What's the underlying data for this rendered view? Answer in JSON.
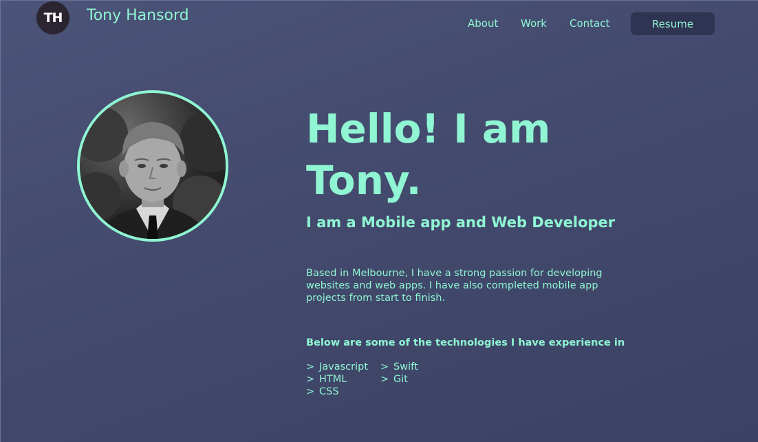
{
  "header": {
    "logo_initials": "TH",
    "brand_name": "Tony Hansord",
    "nav": {
      "about": "About",
      "work": "Work",
      "contact": "Contact",
      "resume": "Resume"
    }
  },
  "hero": {
    "title": "Hello! I am Tony.",
    "subtitle": "I am a Mobile app and Web Developer",
    "bio": "Based in Melbourne, I have a strong passion for developing websites and web apps. I have also completed mobile app projects from start to finish.",
    "tech_heading": "Below are some of the technologies I have experience in",
    "tech_marker": ">",
    "tech_column_1": [
      "Javascript",
      "HTML",
      "CSS"
    ],
    "tech_column_2": [
      "Swift",
      "Git"
    ]
  },
  "colors": {
    "accent": "#8ff5d2",
    "background": "#434a6d",
    "button_bg": "#2f3453",
    "logo_bg": "#2a2530"
  },
  "icons": {
    "avatar": "profile-photo"
  }
}
